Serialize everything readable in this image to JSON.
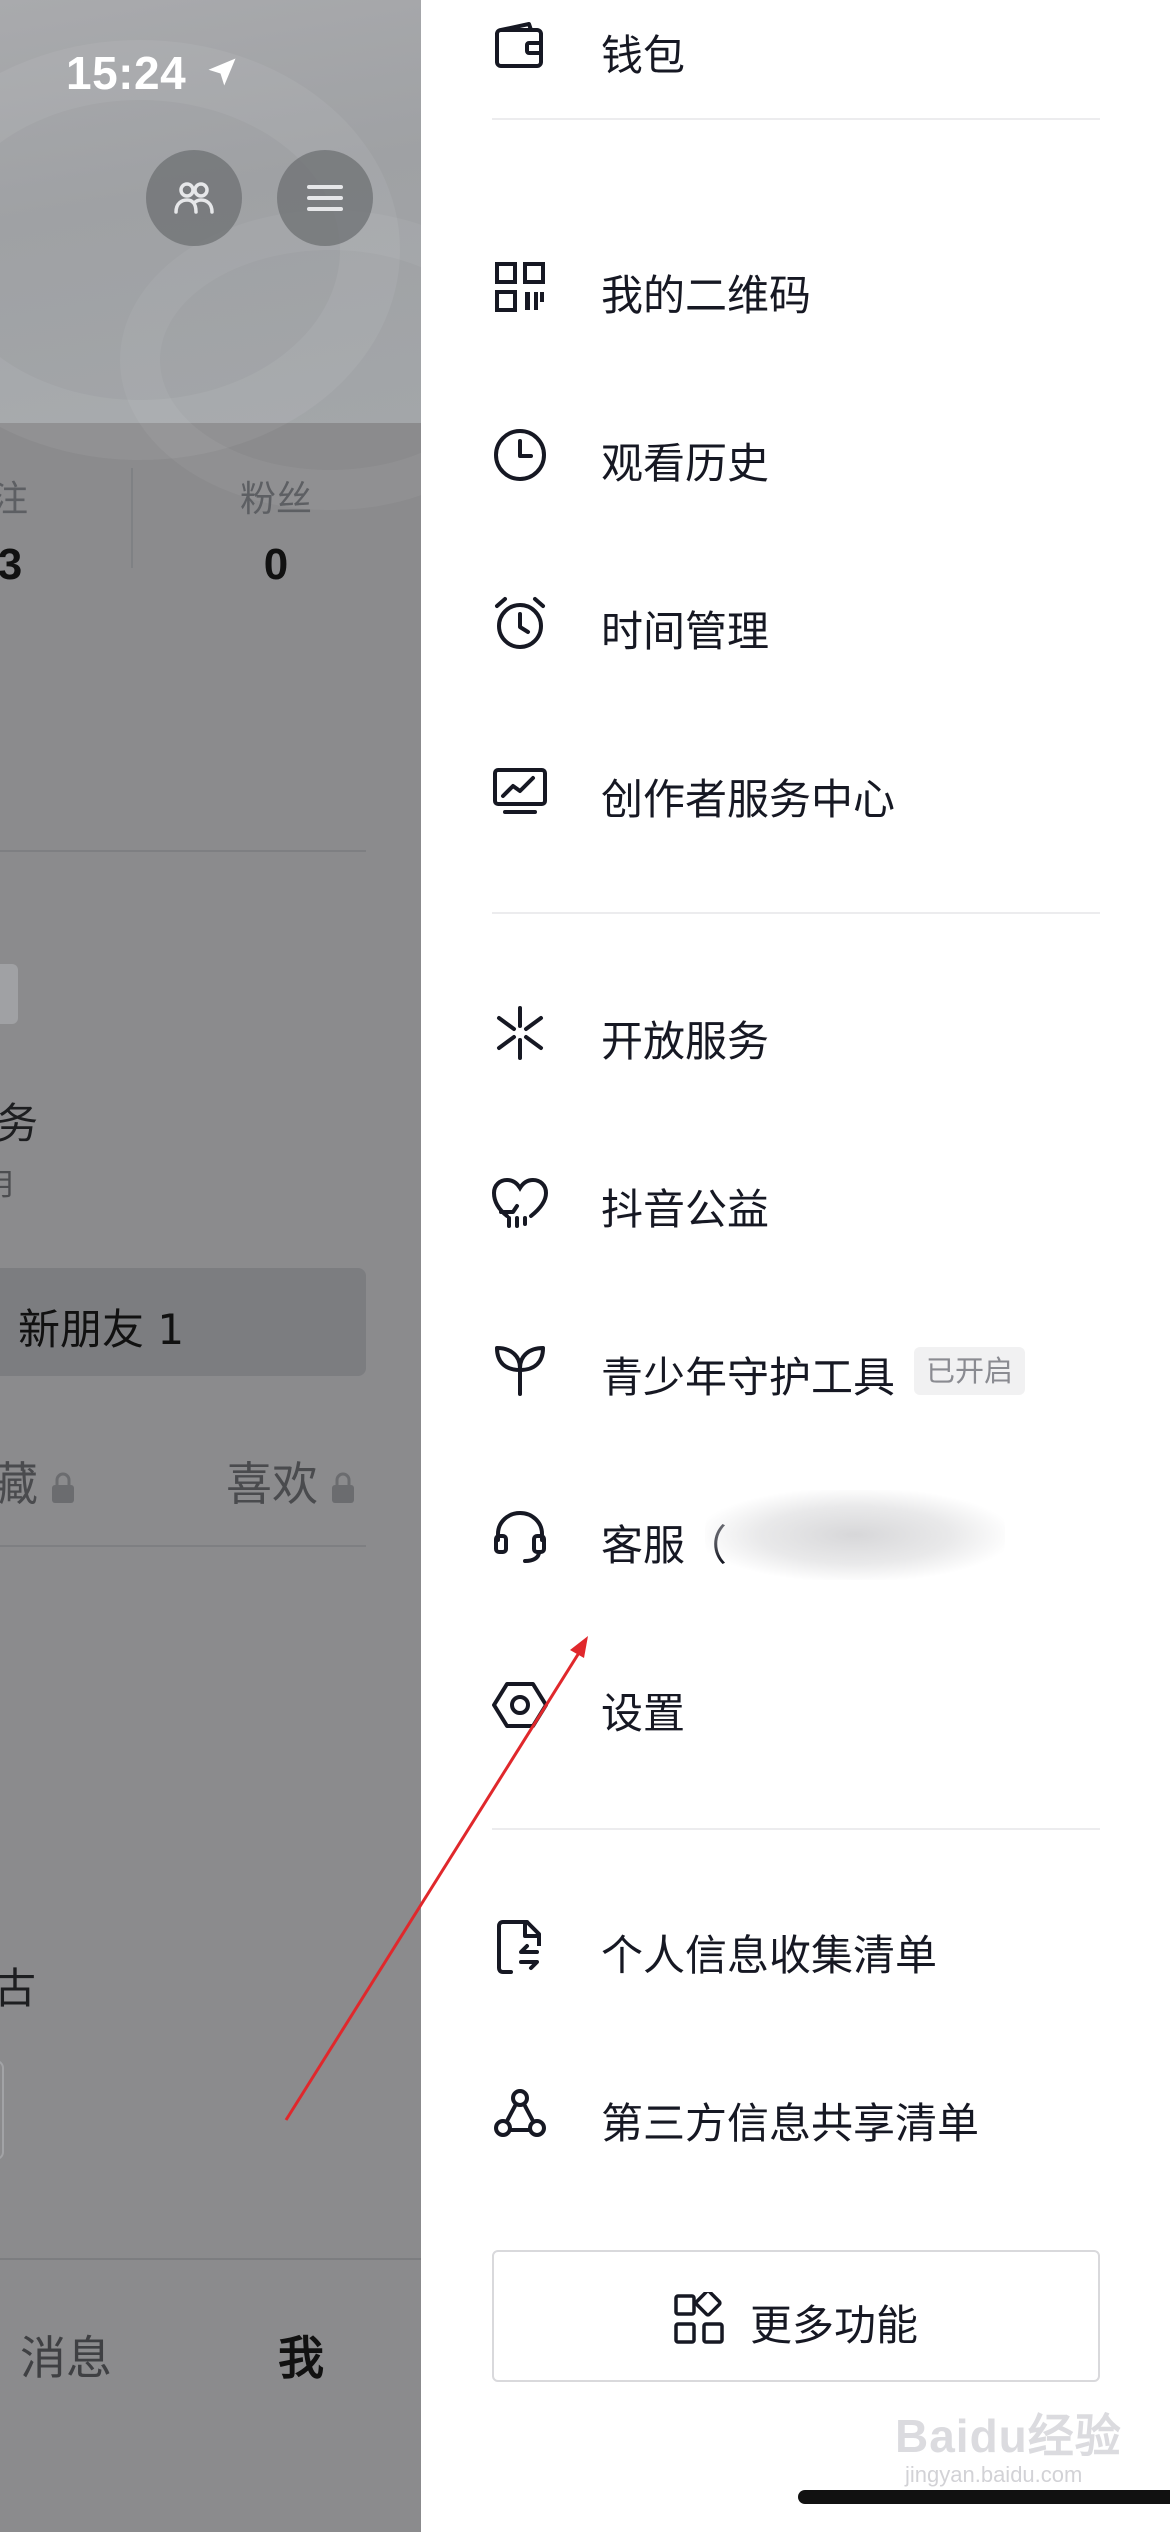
{
  "status_bar": {
    "time": "15:24"
  },
  "profile_page": {
    "stats": [
      {
        "label": "注",
        "value": "3"
      },
      {
        "label": "粉丝",
        "value": "0"
      }
    ],
    "partial_texts": {
      "service_fragment": "务",
      "sub_fragment": "月",
      "new_friend": "新朋友 1",
      "tail_fragment": "古"
    },
    "tabs": [
      {
        "label": "藏",
        "locked": true
      },
      {
        "label": "喜欢",
        "locked": true
      }
    ],
    "bottom_nav": {
      "messages": "消息",
      "me": "我"
    }
  },
  "drawer": {
    "section1": [
      {
        "icon": "wallet-icon",
        "label": "钱包"
      }
    ],
    "section2": [
      {
        "icon": "qr-code-icon",
        "label": "我的二维码"
      },
      {
        "icon": "clock-icon",
        "label": "观看历史"
      },
      {
        "icon": "alarm-clock-icon",
        "label": "时间管理"
      },
      {
        "icon": "creator-monitor-icon",
        "label": "创作者服务中心"
      }
    ],
    "section3": [
      {
        "icon": "open-service-icon",
        "label": "开放服务"
      },
      {
        "icon": "charity-heart-icon",
        "label": "抖音公益"
      },
      {
        "icon": "sprout-icon",
        "label": "青少年守护工具",
        "badge": "已开启"
      },
      {
        "icon": "headset-icon",
        "label": "客服（"
      },
      {
        "icon": "settings-hexagon-icon",
        "label": "设置"
      }
    ],
    "section4": [
      {
        "icon": "document-export-icon",
        "label": "个人信息收集清单"
      },
      {
        "icon": "share-nodes-icon",
        "label": "第三方信息共享清单"
      }
    ],
    "more_button": {
      "icon": "grid-apps-icon",
      "label": "更多功能"
    }
  },
  "watermark": {
    "text": "Baidu经验",
    "sub": "jingyan.baidu.com"
  },
  "colors": {
    "annotation_arrow": "#e0282c",
    "dim_overlay": "#8b8b8d",
    "text": "#161823"
  }
}
